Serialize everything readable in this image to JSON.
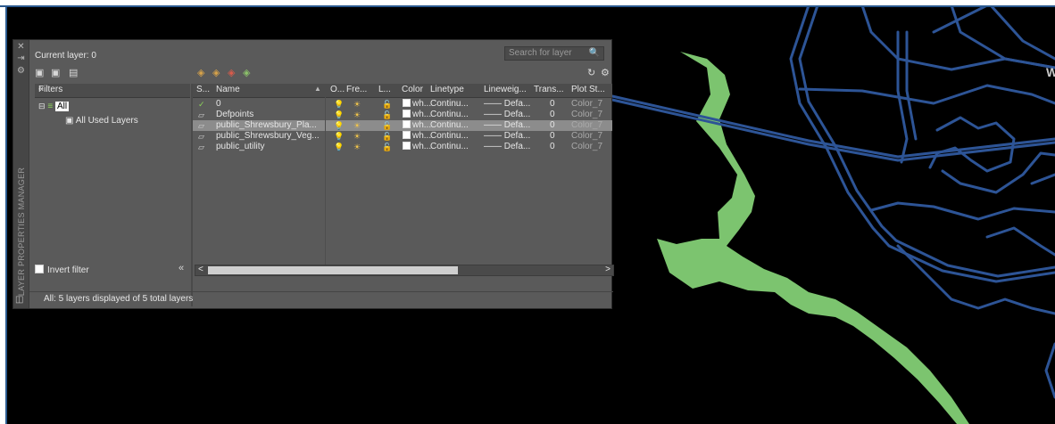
{
  "palette": {
    "vertical_title": "LAYER PROPERTIES MANAGER",
    "current_layer": "Current layer: 0",
    "search_placeholder": "Search for layer",
    "filters_header": "Filters",
    "tree": {
      "all": "All",
      "all_used": "All Used Layers"
    },
    "invert_filter": "Invert filter",
    "status": "All: 5 layers displayed of 5 total layers",
    "columns": [
      "S...",
      "Name",
      "O...",
      "Fre...",
      "L...",
      "Color",
      "Linetype",
      "Lineweig...",
      "Trans...",
      "Plot St..."
    ],
    "layers": [
      {
        "status": "current",
        "name": "0",
        "color": "wh...",
        "linetype": "Continu...",
        "lineweight": "—— Defa...",
        "transparency": "0",
        "plot_style": "Color_7",
        "on": true,
        "selected": false
      },
      {
        "status": "normal",
        "name": "Defpoints",
        "color": "wh...",
        "linetype": "Continu...",
        "lineweight": "—— Defa...",
        "transparency": "0",
        "plot_style": "Color_7",
        "on": true,
        "selected": false
      },
      {
        "status": "normal",
        "name": "public_Shrewsbury_Pla...",
        "color": "wh...",
        "linetype": "Continu...",
        "lineweight": "—— Defa...",
        "transparency": "0",
        "plot_style": "Color_7",
        "on": false,
        "selected": true
      },
      {
        "status": "normal",
        "name": "public_Shrewsbury_Veg...",
        "color": "wh...",
        "linetype": "Continu...",
        "lineweight": "—— Defa...",
        "transparency": "0",
        "plot_style": "Color_7",
        "on": true,
        "selected": false
      },
      {
        "status": "normal",
        "name": "public_utility",
        "color": "wh...",
        "linetype": "Continu...",
        "lineweight": "—— Defa...",
        "transparency": "0",
        "plot_style": "Color_7",
        "on": true,
        "selected": false
      }
    ]
  },
  "drawing": {
    "background": "#000000",
    "vegetation_color": "#7cc46f",
    "road_color": "#2d5496",
    "corner_label": "W"
  }
}
